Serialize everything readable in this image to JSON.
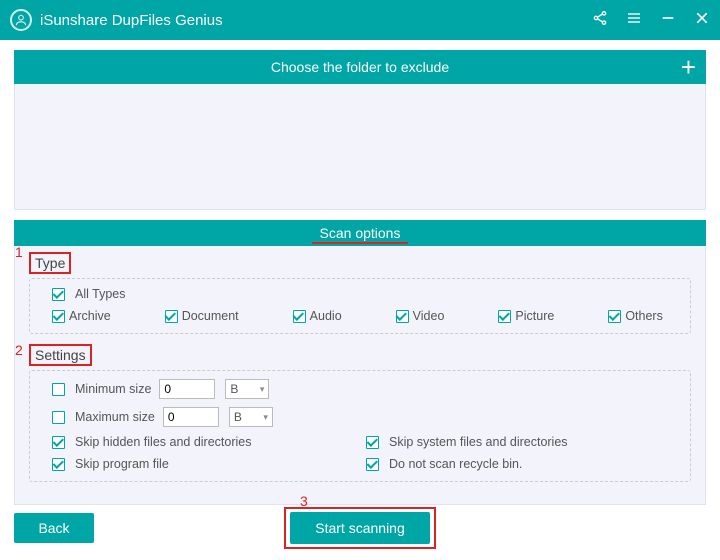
{
  "title": "iSunshare DupFiles Genius",
  "exclude_bar": "Choose the folder to exclude",
  "scan_options_title": "Scan options",
  "sections": {
    "type_label": "Type",
    "settings_label": "Settings"
  },
  "types": {
    "all": "All Types",
    "archive": "Archive",
    "document": "Document",
    "audio": "Audio",
    "video": "Video",
    "picture": "Picture",
    "others": "Others"
  },
  "settings": {
    "min_label": "Minimum size",
    "min_value": "0",
    "min_unit": "B",
    "max_label": "Maximum size",
    "max_value": "0",
    "max_unit": "B",
    "skip_hidden": "Skip hidden files and directories",
    "skip_program": "Skip program file",
    "skip_system": "Skip system files and directories",
    "no_recycle": "Do not scan recycle bin."
  },
  "buttons": {
    "back": "Back",
    "start": "Start scanning"
  },
  "annotations": {
    "a1": "1",
    "a2": "2",
    "a3": "3"
  }
}
